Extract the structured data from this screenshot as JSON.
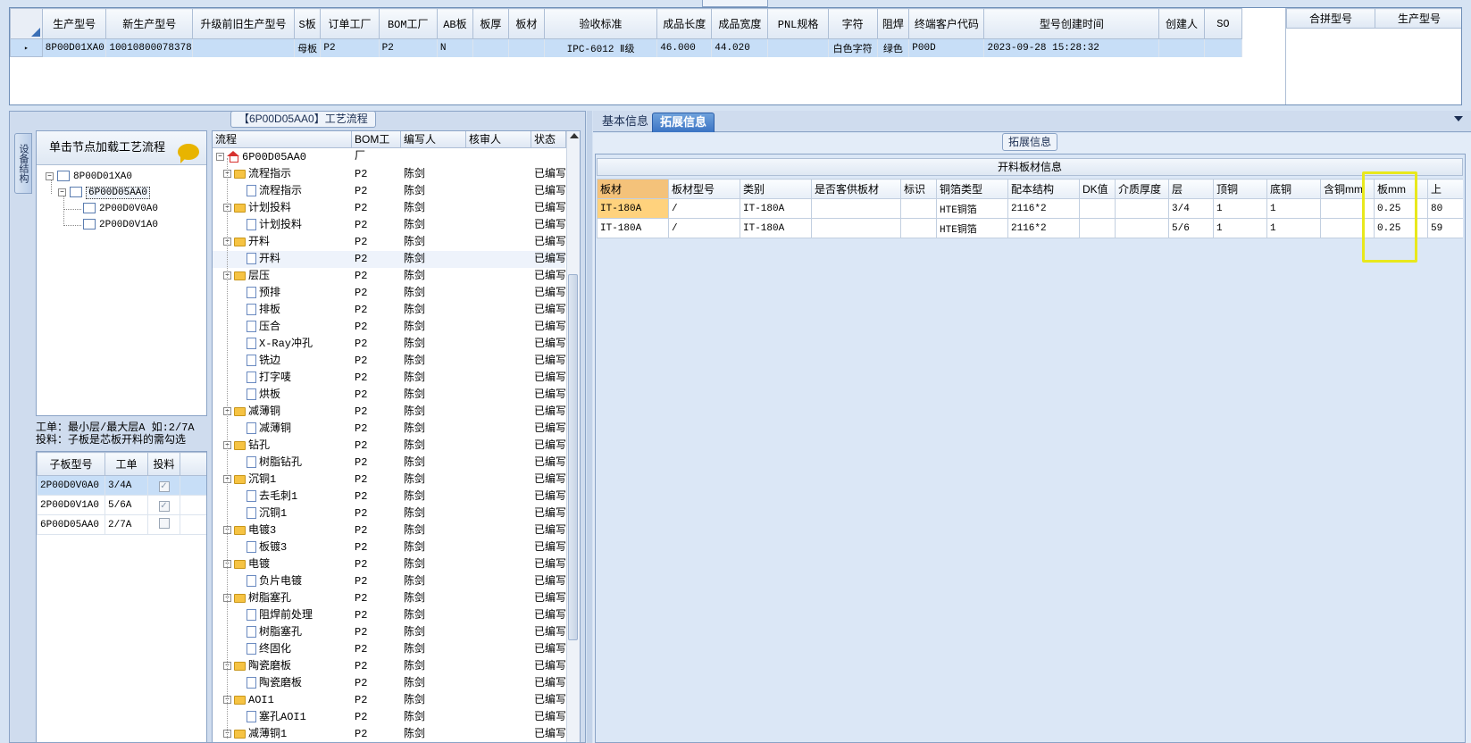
{
  "top": {
    "caption": "",
    "columns": [
      "生产型号",
      "新生产型号",
      "升级前旧生产型号",
      "S板",
      "订单工厂",
      "BOM工厂",
      "AB板",
      "板厚",
      "板材",
      "验收标准",
      "成品长度",
      "成品宽度",
      "PNL规格",
      "字符",
      "阻焊",
      "终端客户代码",
      "型号创建时间",
      "创建人",
      "SO"
    ],
    "row": [
      "8P00D01XA0",
      "10010800078378",
      "",
      "母板",
      "P2",
      "P2",
      "N",
      "",
      "",
      "IPC-6012 Ⅱ级",
      "46.000",
      "44.020",
      "",
      "白色字符",
      "绿色",
      "P00D",
      "2023-09-28 15:28:32",
      "",
      ""
    ],
    "row_marker": "▸",
    "side_columns": [
      "合拼型号",
      "生产型号"
    ]
  },
  "left": {
    "caption": "【6P00D05AA0】工艺流程",
    "vtab": "设备结构",
    "node_header": "单击节点加载工艺流程",
    "tree": [
      "8P00D01XA0",
      "6P00D05AA0",
      "2P00D0V0A0",
      "2P00D0V1A0"
    ],
    "note_line1": "工单：最小层/最大层A 如:2/7A",
    "note_line2": "投料：子板是芯板开料的需勾选",
    "sub_columns": [
      "子板型号",
      "工单",
      "投料"
    ],
    "sub_rows": [
      {
        "model": "2P00D0V0A0",
        "order": "3/4A",
        "checked": true
      },
      {
        "model": "2P00D0V1A0",
        "order": "5/6A",
        "checked": true
      },
      {
        "model": "6P00D05AA0",
        "order": "2/7A",
        "checked": false
      }
    ]
  },
  "flow": {
    "columns": [
      "流程",
      "BOM工厂",
      "编写人",
      "核审人",
      "状态"
    ],
    "root": "6P00D05AA0",
    "rows": [
      {
        "label": "流程指示",
        "type": "folder",
        "bom": "P2",
        "writer": "陈剑",
        "status": "已编写"
      },
      {
        "label": "流程指示",
        "type": "doc",
        "bom": "P2",
        "writer": "陈剑",
        "status": "已编写"
      },
      {
        "label": "计划投料",
        "type": "folder",
        "bom": "P2",
        "writer": "陈剑",
        "status": "已编写"
      },
      {
        "label": "计划投料",
        "type": "doc",
        "bom": "P2",
        "writer": "陈剑",
        "status": "已编写"
      },
      {
        "label": "开料",
        "type": "folder",
        "bom": "P2",
        "writer": "陈剑",
        "status": "已编写"
      },
      {
        "label": "开料",
        "type": "doc",
        "bom": "P2",
        "writer": "陈剑",
        "status": "已编写"
      },
      {
        "label": "层压",
        "type": "folder",
        "bom": "P2",
        "writer": "陈剑",
        "status": "已编写"
      },
      {
        "label": "预排",
        "type": "doc",
        "bom": "P2",
        "writer": "陈剑",
        "status": "已编写"
      },
      {
        "label": "排板",
        "type": "doc",
        "bom": "P2",
        "writer": "陈剑",
        "status": "已编写"
      },
      {
        "label": "压合",
        "type": "doc",
        "bom": "P2",
        "writer": "陈剑",
        "status": "已编写"
      },
      {
        "label": "X-Ray冲孔",
        "type": "doc",
        "bom": "P2",
        "writer": "陈剑",
        "status": "已编写"
      },
      {
        "label": "铣边",
        "type": "doc",
        "bom": "P2",
        "writer": "陈剑",
        "status": "已编写"
      },
      {
        "label": "打字唛",
        "type": "doc",
        "bom": "P2",
        "writer": "陈剑",
        "status": "已编写"
      },
      {
        "label": "烘板",
        "type": "doc",
        "bom": "P2",
        "writer": "陈剑",
        "status": "已编写"
      },
      {
        "label": "减薄铜",
        "type": "folder",
        "bom": "P2",
        "writer": "陈剑",
        "status": "已编写"
      },
      {
        "label": "减薄铜",
        "type": "doc",
        "bom": "P2",
        "writer": "陈剑",
        "status": "已编写"
      },
      {
        "label": "钻孔",
        "type": "folder",
        "bom": "P2",
        "writer": "陈剑",
        "status": "已编写"
      },
      {
        "label": "树脂钻孔",
        "type": "doc",
        "bom": "P2",
        "writer": "陈剑",
        "status": "已编写"
      },
      {
        "label": "沉铜1",
        "type": "folder",
        "bom": "P2",
        "writer": "陈剑",
        "status": "已编写"
      },
      {
        "label": "去毛刺1",
        "type": "doc",
        "bom": "P2",
        "writer": "陈剑",
        "status": "已编写"
      },
      {
        "label": "沉铜1",
        "type": "doc",
        "bom": "P2",
        "writer": "陈剑",
        "status": "已编写"
      },
      {
        "label": "电镀3",
        "type": "folder",
        "bom": "P2",
        "writer": "陈剑",
        "status": "已编写"
      },
      {
        "label": "板镀3",
        "type": "doc",
        "bom": "P2",
        "writer": "陈剑",
        "status": "已编写"
      },
      {
        "label": "电镀",
        "type": "folder",
        "bom": "P2",
        "writer": "陈剑",
        "status": "已编写"
      },
      {
        "label": "负片电镀",
        "type": "doc",
        "bom": "P2",
        "writer": "陈剑",
        "status": "已编写"
      },
      {
        "label": "树脂塞孔",
        "type": "folder",
        "bom": "P2",
        "writer": "陈剑",
        "status": "已编写"
      },
      {
        "label": "阻焊前处理",
        "type": "doc",
        "bom": "P2",
        "writer": "陈剑",
        "status": "已编写"
      },
      {
        "label": "树脂塞孔",
        "type": "doc",
        "bom": "P2",
        "writer": "陈剑",
        "status": "已编写"
      },
      {
        "label": "终固化",
        "type": "doc",
        "bom": "P2",
        "writer": "陈剑",
        "status": "已编写"
      },
      {
        "label": "陶瓷磨板",
        "type": "folder",
        "bom": "P2",
        "writer": "陈剑",
        "status": "已编写"
      },
      {
        "label": "陶瓷磨板",
        "type": "doc",
        "bom": "P2",
        "writer": "陈剑",
        "status": "已编写"
      },
      {
        "label": "AOI1",
        "type": "folder",
        "bom": "P2",
        "writer": "陈剑",
        "status": "已编写"
      },
      {
        "label": "塞孔AOI1",
        "type": "doc",
        "bom": "P2",
        "writer": "陈剑",
        "status": "已编写"
      },
      {
        "label": "减薄铜1",
        "type": "folder",
        "bom": "P2",
        "writer": "陈剑",
        "status": "已编写"
      }
    ]
  },
  "right": {
    "tabs": [
      "基本信息",
      "拓展信息"
    ],
    "caption": "拓展信息",
    "table_title": "开料板材信息",
    "columns": [
      "板材",
      "板材型号",
      "类别",
      "是否客供板材",
      "标识",
      "铜箔类型",
      "配本结构",
      "DK值",
      "介质厚度",
      "层",
      "顶铜",
      "底铜",
      "含铜mm",
      "板mm",
      "上"
    ],
    "rows": [
      [
        "IT-180A",
        "/",
        "IT-180A",
        "",
        "",
        "HTE铜箔",
        "2116*2",
        "",
        "",
        "3/4",
        "1",
        "1",
        "",
        "0.25",
        "80"
      ],
      [
        "IT-180A",
        "/",
        "IT-180A",
        "",
        "",
        "HTE铜箔",
        "2116*2",
        "",
        "",
        "5/6",
        "1",
        "1",
        "",
        "0.25",
        "59"
      ]
    ],
    "highlight_color": "#e8e81c"
  },
  "colors": {
    "selection": "#c7def7",
    "active_tab": "#3b74c4",
    "current_cell": "#ffd27d"
  }
}
